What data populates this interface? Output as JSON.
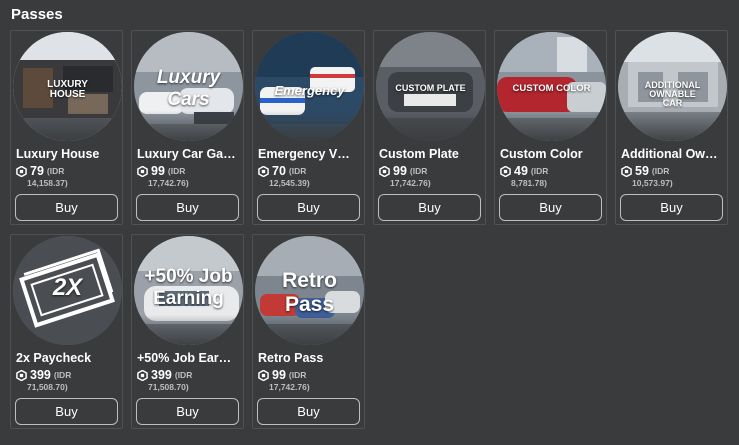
{
  "section": {
    "title": "Passes"
  },
  "colors": {
    "background": "#393b3d",
    "card_border": "#4f5153",
    "button_border": "#bdbebe",
    "muted_text": "#bdbebe"
  },
  "icons": {
    "currency": "robux-icon"
  },
  "passes": [
    {
      "name": "Luxury House",
      "price": "79",
      "idr_label": "(IDR",
      "idr_value": "14,158.37)",
      "buy_label": "Buy",
      "thumb_text": [
        "LUXURY",
        "HOUSE"
      ]
    },
    {
      "name": "Luxury Car Ga…",
      "price": "99",
      "idr_label": "(IDR",
      "idr_value": "17,742.76)",
      "buy_label": "Buy",
      "thumb_text": [
        "Luxury",
        "Cars"
      ]
    },
    {
      "name": "Emergency V…",
      "price": "70",
      "idr_label": "(IDR",
      "idr_value": "12,545.39)",
      "buy_label": "Buy",
      "thumb_text": [
        "Emergency"
      ]
    },
    {
      "name": "Custom Plate",
      "price": "99",
      "idr_label": "(IDR",
      "idr_value": "17,742.76)",
      "buy_label": "Buy",
      "thumb_text": [
        "CUSTOM PLATE"
      ]
    },
    {
      "name": "Custom Color",
      "price": "49",
      "idr_label": "(IDR",
      "idr_value": "8,781.78)",
      "buy_label": "Buy",
      "thumb_text": [
        "CUSTOM COLOR"
      ]
    },
    {
      "name": "Additional Ow…",
      "price": "59",
      "idr_label": "(IDR",
      "idr_value": "10,573.97)",
      "buy_label": "Buy",
      "thumb_text": [
        "ADDITIONAL",
        "OWNABLE",
        "CAR"
      ]
    },
    {
      "name": "2x Paycheck",
      "price": "399",
      "idr_label": "(IDR",
      "idr_value": "71,508.70)",
      "buy_label": "Buy",
      "thumb_text": [
        "2X"
      ]
    },
    {
      "name": "+50% Job Ear…",
      "price": "399",
      "idr_label": "(IDR",
      "idr_value": "71,508.70)",
      "buy_label": "Buy",
      "thumb_text": [
        "+50% Job",
        "Earning"
      ]
    },
    {
      "name": "Retro Pass",
      "price": "99",
      "idr_label": "(IDR",
      "idr_value": "17,742.76)",
      "buy_label": "Buy",
      "thumb_text": [
        "Retro",
        "Pass"
      ]
    }
  ]
}
